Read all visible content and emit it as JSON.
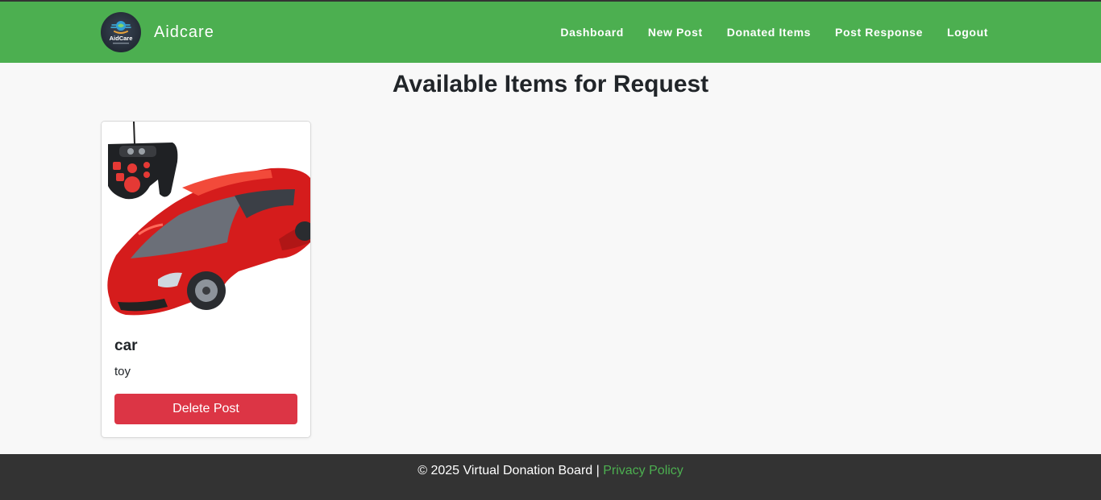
{
  "header": {
    "brand_name": "Aidcare",
    "logo_text": "AidCare",
    "logo_icon": "aidcare-logo-icon",
    "nav": [
      {
        "label": "Dashboard"
      },
      {
        "label": "New Post"
      },
      {
        "label": "Donated Items"
      },
      {
        "label": "Post Response"
      },
      {
        "label": "Logout"
      }
    ]
  },
  "main": {
    "title": "Available Items for Request",
    "items": [
      {
        "name": "car",
        "category": "toy",
        "image": "red-toy-car-with-remote-control",
        "action_label": "Delete Post"
      }
    ]
  },
  "footer": {
    "copyright": "© 2025 Virtual Donation Board | ",
    "privacy_link": "Privacy Policy"
  },
  "colors": {
    "navbar": "#4caf50",
    "delete_button": "#dc3545",
    "footer": "#333333",
    "link": "#4caf50"
  }
}
